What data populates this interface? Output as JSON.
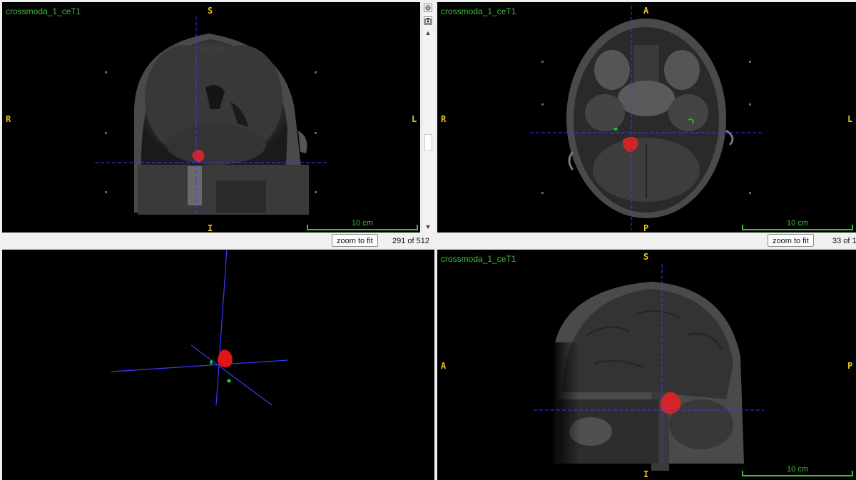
{
  "views": {
    "coronal": {
      "title": "crossmoda_1_ceT1",
      "orient": {
        "top": "S",
        "bottom": "I",
        "left": "R",
        "right": "L"
      },
      "scale_label": "10 cm"
    },
    "axial": {
      "title": "crossmoda_1_ceT1",
      "orient": {
        "top": "A",
        "bottom": "P",
        "left": "R",
        "right": "L"
      },
      "scale_label": "10 cm"
    },
    "sagittal": {
      "title": "crossmoda_1_ceT1",
      "orient": {
        "top": "S",
        "bottom": "I",
        "left": "A",
        "right": "P"
      },
      "scale_label": "10 cm"
    },
    "render3d": {}
  },
  "controls": {
    "left": {
      "zoom_label": "zoom to fit",
      "slice_text": "291 of 512"
    },
    "right": {
      "zoom_label": "zoom to fit",
      "slice_text": "33 of 1"
    }
  },
  "scrollbar": {
    "top_icon": "settings-icon",
    "second_icon": "camera-icon",
    "arrow_up": "▲",
    "arrow_down": "▼"
  },
  "colors": {
    "crosshair": "#3a3aff",
    "title": "#3fbf3f",
    "orientation": "#e6c31f",
    "tumor": "#d32525",
    "cochlea": "#1fc11f"
  }
}
